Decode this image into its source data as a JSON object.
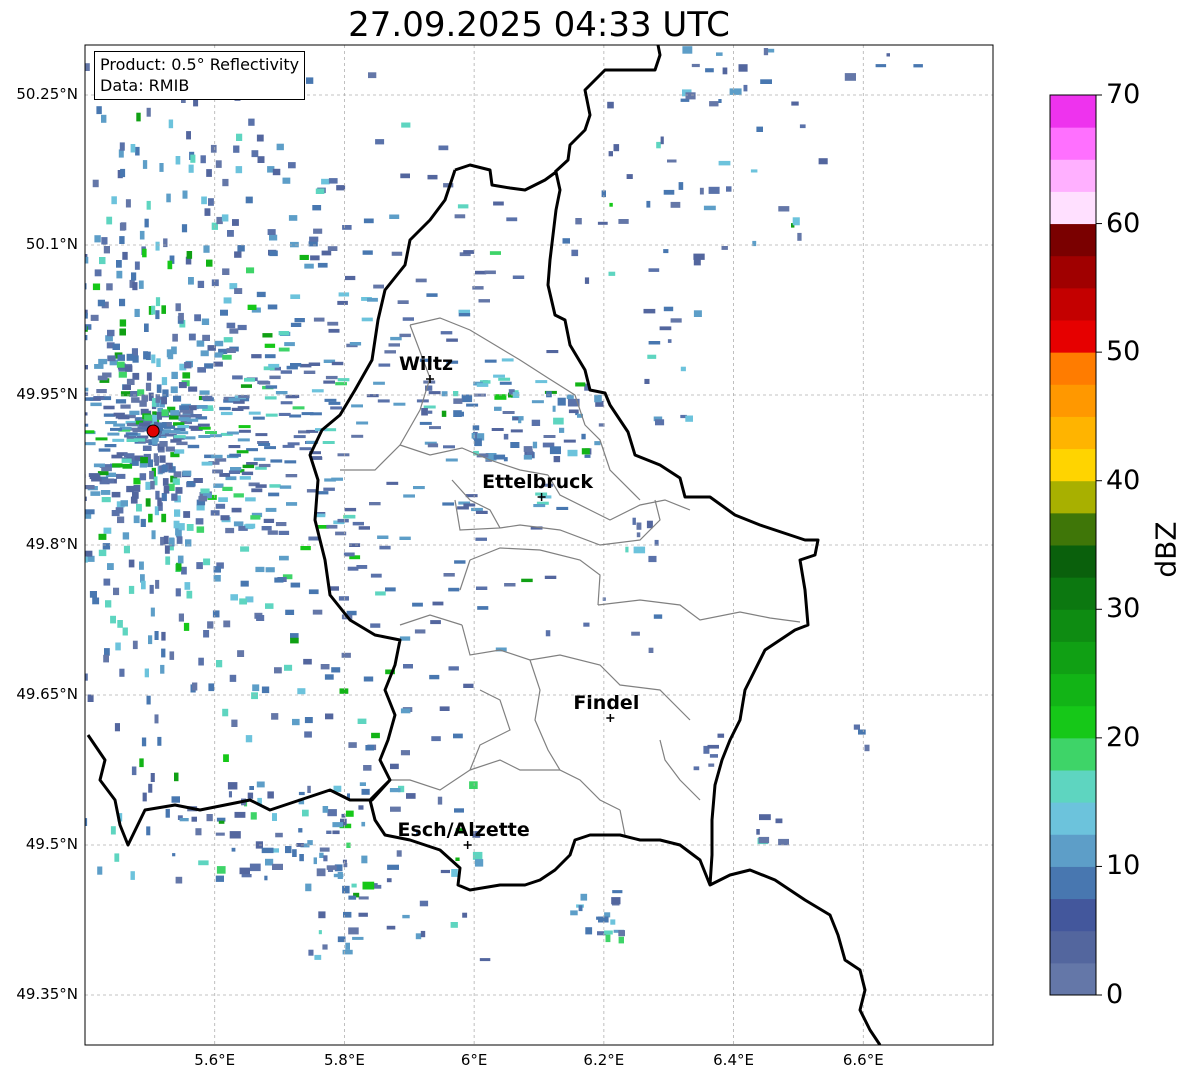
{
  "title": "27.09.2025 04:33 UTC",
  "info_box": {
    "product": "Product: 0.5° Reflectivity",
    "data_source": "Data: RMIB"
  },
  "map": {
    "extent": {
      "lon": [
        5.4,
        6.8
      ],
      "lat": [
        49.3,
        50.3
      ]
    },
    "lat_ticks": [
      {
        "value": 50.25,
        "label": "50.25°N"
      },
      {
        "value": 50.1,
        "label": "50.1°N"
      },
      {
        "value": 49.95,
        "label": "49.95°N"
      },
      {
        "value": 49.8,
        "label": "49.8°N"
      },
      {
        "value": 49.65,
        "label": "49.65°N"
      },
      {
        "value": 49.5,
        "label": "49.5°N"
      },
      {
        "value": 49.35,
        "label": "49.35°N"
      }
    ],
    "lon_ticks": [
      {
        "value": 5.6,
        "label": "5.6°E"
      },
      {
        "value": 5.8,
        "label": "5.8°E"
      },
      {
        "value": 6.0,
        "label": "6°E"
      },
      {
        "value": 6.2,
        "label": "6.2°E"
      },
      {
        "value": 6.4,
        "label": "6.4°E"
      },
      {
        "value": 6.6,
        "label": "6.6°E"
      }
    ],
    "grid": true,
    "radar_site": {
      "lon": 5.505,
      "lat": 49.914,
      "color": "#e00000"
    },
    "cities": [
      {
        "name": "Wiltz",
        "lon": 5.932,
        "lat": 49.966
      },
      {
        "name": "Ettelbruck",
        "lon": 6.104,
        "lat": 49.848
      },
      {
        "name": "Findel",
        "lon": 6.21,
        "lat": 49.627
      },
      {
        "name": "Esch/Alzette",
        "lon": 5.99,
        "lat": 49.5
      }
    ]
  },
  "colorbar": {
    "label": "dBZ",
    "ticks": [
      {
        "value": 70,
        "label": "70"
      },
      {
        "value": 60,
        "label": "60"
      },
      {
        "value": 50,
        "label": "50"
      },
      {
        "value": 40,
        "label": "40"
      },
      {
        "value": 30,
        "label": "30"
      },
      {
        "value": 20,
        "label": "20"
      },
      {
        "value": 10,
        "label": "10"
      },
      {
        "value": 0,
        "label": "0"
      }
    ],
    "range": [
      0,
      70
    ],
    "colors": [
      "#6477a8",
      "#53669e",
      "#43579c",
      "#4877b0",
      "#5d9ec8",
      "#6cc3dc",
      "#5ed5c0",
      "#3ed468",
      "#16c818",
      "#12b416",
      "#10a014",
      "#0e8c12",
      "#0c7810",
      "#0a600c",
      "#3f7608",
      "#a8b000",
      "#ffd400",
      "#ffb400",
      "#ff9800",
      "#ff7c00",
      "#e60000",
      "#c40000",
      "#a00000",
      "#7a0000",
      "#ffe0ff",
      "#ffb0ff",
      "#ff70ff",
      "#ee33ee"
    ]
  },
  "colors": {
    "country_border": "#000000",
    "canton_border": "#808080",
    "grid": "#b0b0b0"
  }
}
